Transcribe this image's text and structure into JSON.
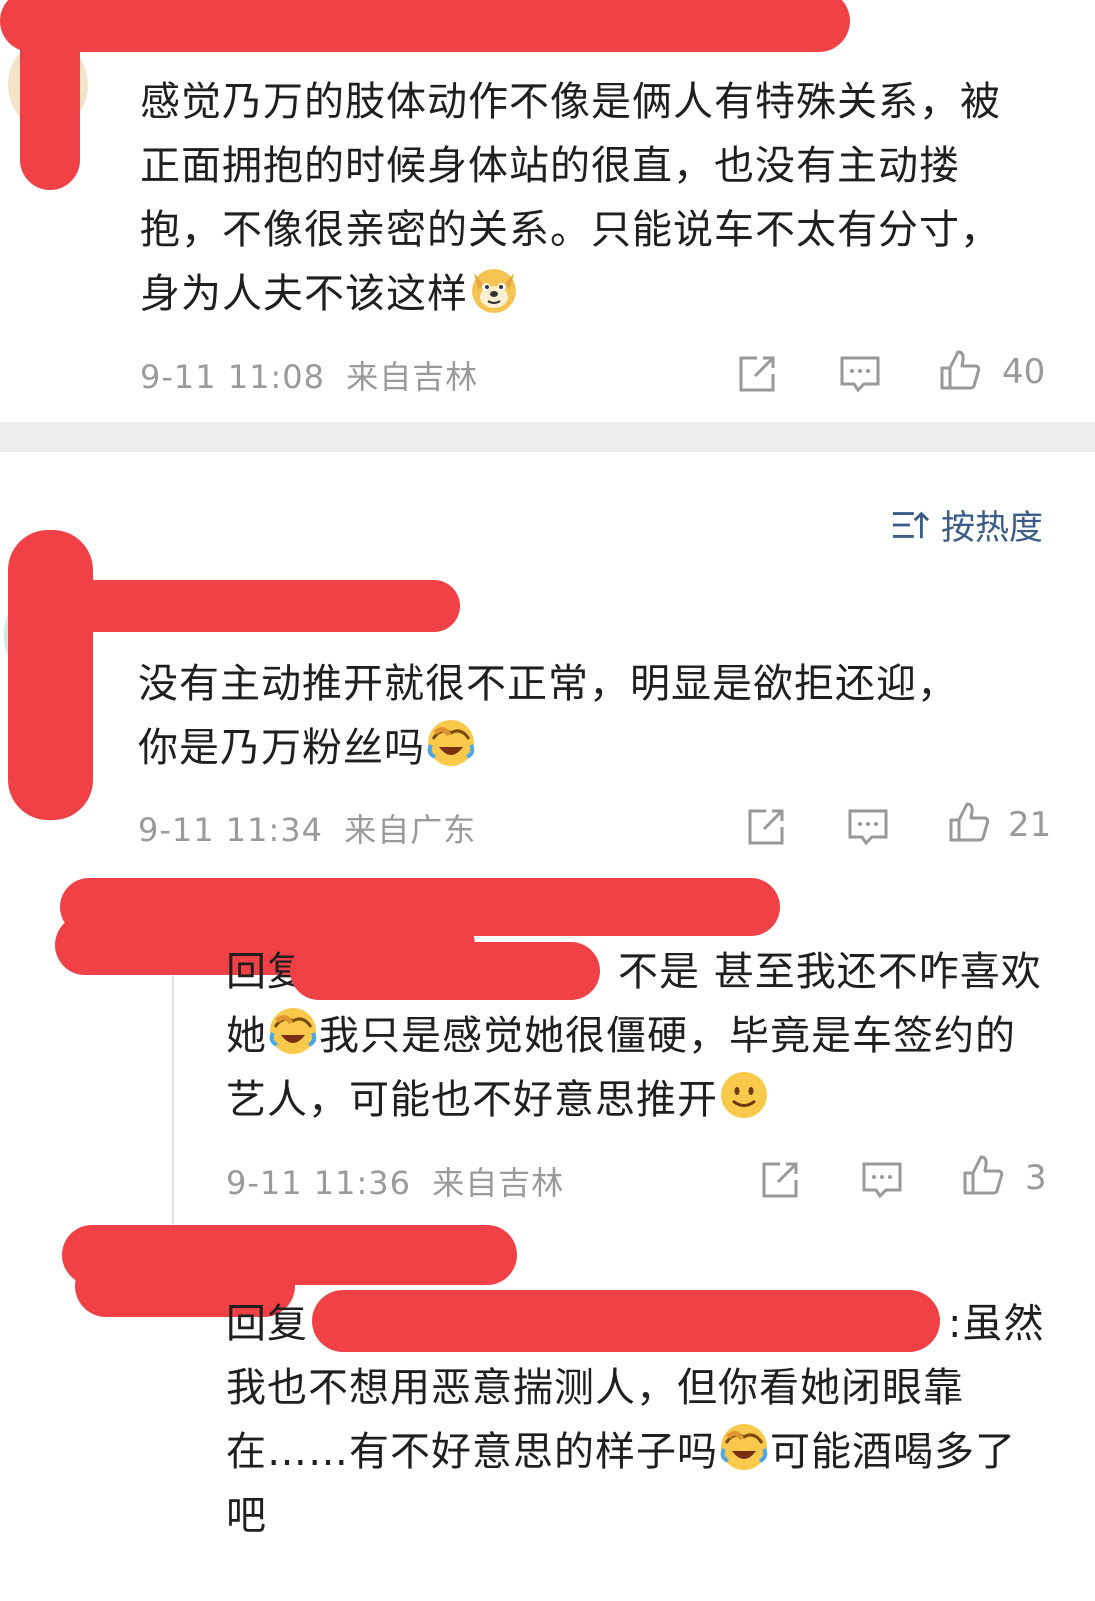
{
  "comments": [
    {
      "text": "感觉乃万的肢体动作不像是俩人有特殊关系，被正面拥抱的时候身体站的很直，也没有主动搂抱，不像很亲密的关系。只能说车不太有分寸，身为人夫不该这样",
      "emoji": "doge",
      "time": "9-11 11:08",
      "location": "来自吉林",
      "likes": "40"
    },
    {
      "text": "没有主动推开就很不正常，明显是欲拒还迎，你是乃万粉丝吗",
      "emoji": "laugh-cry",
      "time": "9-11 11:34",
      "location": "来自广东",
      "likes": "21"
    }
  ],
  "sort_label": "按热度",
  "replies": [
    {
      "prefix": "回复",
      "text_after_mention": "不是 甚至我还不咋喜欢她",
      "text_mid": "我只是感觉她很僵硬，毕竟是车签约的艺人，可能也不好意思推开",
      "time": "9-11 11:36",
      "location": "来自吉林",
      "likes": "3"
    },
    {
      "prefix": "回复",
      "text_after_mention": ":虽然我也不想用恶意揣测人，但你看她闭眼靠在……有不好意思的样子吗",
      "text_end": "可能酒喝多了吧"
    }
  ],
  "colors": {
    "redaction": "#ef4146",
    "meta_gray": "#9a9a9a",
    "sort_blue": "#3a5c88",
    "divider": "#ececec"
  },
  "icons": [
    "share-icon",
    "comment-icon",
    "thumbs-up-icon",
    "sort-icon"
  ]
}
